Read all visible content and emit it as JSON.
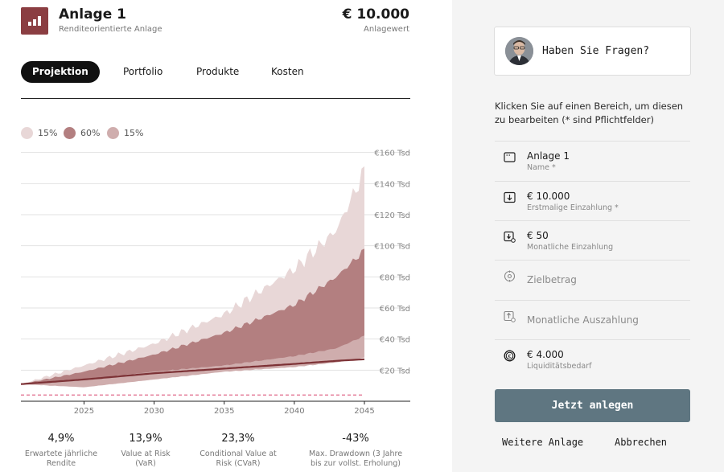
{
  "header": {
    "title": "Anlage 1",
    "subtitle": "Renditeorientierte Anlage",
    "amount": "€ 10.000",
    "amount_label": "Anlagewert"
  },
  "tabs": [
    {
      "label": "Projektion",
      "active": true
    },
    {
      "label": "Portfolio",
      "active": false
    },
    {
      "label": "Produkte",
      "active": false
    },
    {
      "label": "Kosten",
      "active": false
    }
  ],
  "legend": [
    {
      "label": "15%",
      "color": "#e8d7d7"
    },
    {
      "label": "60%",
      "color": "#b37f80"
    },
    {
      "label": "15%",
      "color": "#cfadad"
    }
  ],
  "chart_data": {
    "type": "area",
    "x_ticks": [
      "2025",
      "2030",
      "2035",
      "2040",
      "2045"
    ],
    "y_ticks": [
      "€20 Tsd",
      "€40 Tsd",
      "€60 Tsd",
      "€80 Tsd",
      "€100 Tsd",
      "€120 Tsd",
      "€140 Tsd",
      "€160 Tsd"
    ],
    "ylim": [
      0,
      165
    ],
    "x": [
      2020.5,
      2025,
      2030,
      2035,
      2040,
      2043,
      2045
    ],
    "bands": {
      "outer_upper": [
        11,
        23,
        37,
        56,
        85,
        110,
        148
      ],
      "inner_upper": [
        11,
        19,
        30,
        44,
        62,
        80,
        97
      ],
      "inner_lower": [
        11,
        14,
        19,
        23,
        29,
        34,
        42
      ],
      "outer_lower": [
        11,
        9,
        14,
        19,
        22,
        25,
        28
      ]
    },
    "median": [
      11,
      14,
      18,
      21,
      24,
      26,
      27
    ],
    "threshold": 4,
    "colors": {
      "outer": "#e8d7d7",
      "inner_upper": "#dcc3c3",
      "middle": "#b37f80",
      "lower": "#cfadad",
      "median": "#7d3236",
      "threshold": "#e06a8a"
    }
  },
  "metrics": [
    {
      "value": "4,9%",
      "label": [
        "Erwartete jährliche",
        "Rendite"
      ]
    },
    {
      "value": "13,9%",
      "label": [
        "Value at Risk",
        "(VaR)"
      ]
    },
    {
      "value": "23,3%",
      "label": [
        "Conditional Value at",
        "Risk (CVaR)"
      ]
    },
    {
      "value": "-43%",
      "label": [
        "Max. Drawdown (3 Jahre",
        "bis zur vollst. Erholung)"
      ]
    }
  ],
  "help": {
    "text": "Haben Sie Fragen?"
  },
  "instruction": "Klicken Sie auf einen Bereich, um diesen zu bearbeiten (* sind Pflichtfelder)",
  "fields": [
    {
      "icon": "name-icon",
      "value": "Anlage 1",
      "label": "Name *"
    },
    {
      "icon": "deposit-icon",
      "value": "€ 10.000",
      "label": "Erstmalige Einzahlung *"
    },
    {
      "icon": "monthly-deposit-icon",
      "value": "€ 50",
      "label": "Monatliche Einzahlung"
    },
    {
      "icon": "target-icon",
      "placeholder": "Zielbetrag"
    },
    {
      "icon": "monthly-payout-icon",
      "placeholder": "Monatliche Auszahlung"
    },
    {
      "icon": "liquidity-icon",
      "value": "€ 4.000",
      "label": "Liquiditätsbedarf"
    }
  ],
  "actions": {
    "primary": "Jetzt anlegen",
    "secondary": "Weitere Anlage",
    "cancel": "Abbrechen"
  }
}
